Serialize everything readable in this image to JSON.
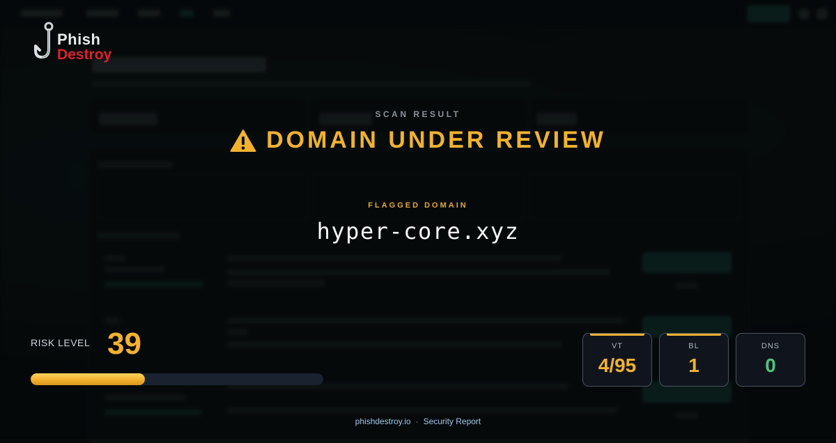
{
  "brand": {
    "name_line1": "Phish",
    "name_line2": "Destroy",
    "icon": "fishhook-icon"
  },
  "scan": {
    "label": "SCAN RESULT",
    "headline": "DOMAIN UNDER REVIEW",
    "status_icon": "warning-triangle-icon",
    "flagged_label": "FLAGGED DOMAIN",
    "domain": "hyper-core.xyz"
  },
  "risk": {
    "label": "RISK LEVEL",
    "value": "39",
    "percent": 39
  },
  "stats": [
    {
      "label": "VT",
      "value": "4/95",
      "color": "#f2b230"
    },
    {
      "label": "BL",
      "value": "1",
      "color": "#f2b230"
    },
    {
      "label": "DNS",
      "value": "0",
      "color": "#4fc37e"
    }
  ],
  "footer": {
    "site": "phishdestroy.io",
    "separator": "·",
    "report": "Security Report"
  },
  "colors": {
    "accent": "#f2b230",
    "brand_red": "#d9232b",
    "ok_green": "#4fc37e"
  }
}
